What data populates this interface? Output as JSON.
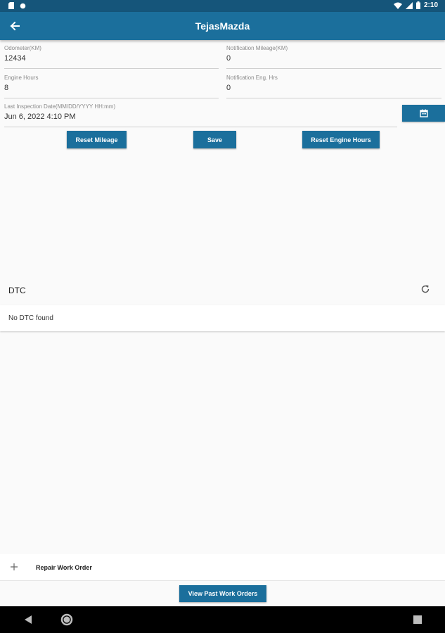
{
  "status_bar": {
    "time": "2:10"
  },
  "app_bar": {
    "title": "TejasMazda"
  },
  "fields": {
    "odometer": {
      "label": "Odometer(KM)",
      "value": "12434"
    },
    "notification_mileage": {
      "label": "Notification Mileage(KM)",
      "value": "0"
    },
    "engine_hours": {
      "label": "Engine Hours",
      "value": "8"
    },
    "notification_eng_hrs": {
      "label": "Notification Eng. Hrs",
      "value": "0"
    },
    "last_inspection": {
      "label": "Last Inspection Date(MM/DD/YYYY HH:mm)",
      "value": "Jun 6, 2022 4:10 PM"
    }
  },
  "buttons": {
    "reset_mileage": "Reset Mileage",
    "save": "Save",
    "reset_engine_hours": "Reset Engine Hours",
    "view_past_work_orders": "View Past Work Orders"
  },
  "dtc": {
    "title": "DTC",
    "empty_message": "No DTC found"
  },
  "repair": {
    "label": "Repair Work Order"
  },
  "icons": {
    "back": "arrow-back-icon",
    "calendar": "calendar-icon",
    "refresh": "refresh-icon",
    "add": "plus-icon"
  },
  "colors": {
    "primary": "#1b6f9c",
    "status_bar": "#15557a",
    "background": "#fafafa"
  }
}
